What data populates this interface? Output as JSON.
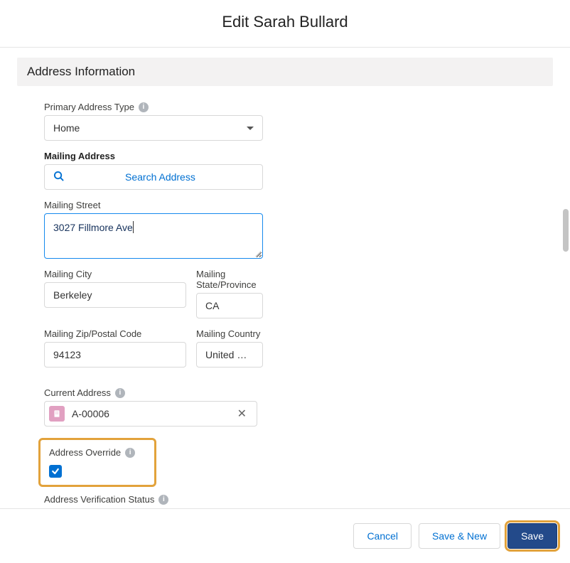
{
  "modal": {
    "title": "Edit Sarah Bullard"
  },
  "section": {
    "title": "Address Information"
  },
  "primary_address_type": {
    "label": "Primary Address Type",
    "value": "Home"
  },
  "mailing_address": {
    "label": "Mailing Address",
    "search_label": "Search Address"
  },
  "mailing_street": {
    "label": "Mailing Street",
    "value": "3027 Fillmore Ave"
  },
  "mailing_city": {
    "label": "Mailing City",
    "value": "Berkeley"
  },
  "mailing_state": {
    "label": "Mailing State/Province",
    "value": "CA"
  },
  "mailing_zip": {
    "label": "Mailing Zip/Postal Code",
    "value": "94123"
  },
  "mailing_country": {
    "label": "Mailing Country",
    "value": "United …"
  },
  "current_address": {
    "label": "Current Address",
    "value": "A-00006"
  },
  "address_override": {
    "label": "Address Override",
    "checked": true
  },
  "verification_status": {
    "label": "Address Verification Status"
  },
  "footer": {
    "cancel": "Cancel",
    "save_new": "Save & New",
    "save": "Save"
  }
}
